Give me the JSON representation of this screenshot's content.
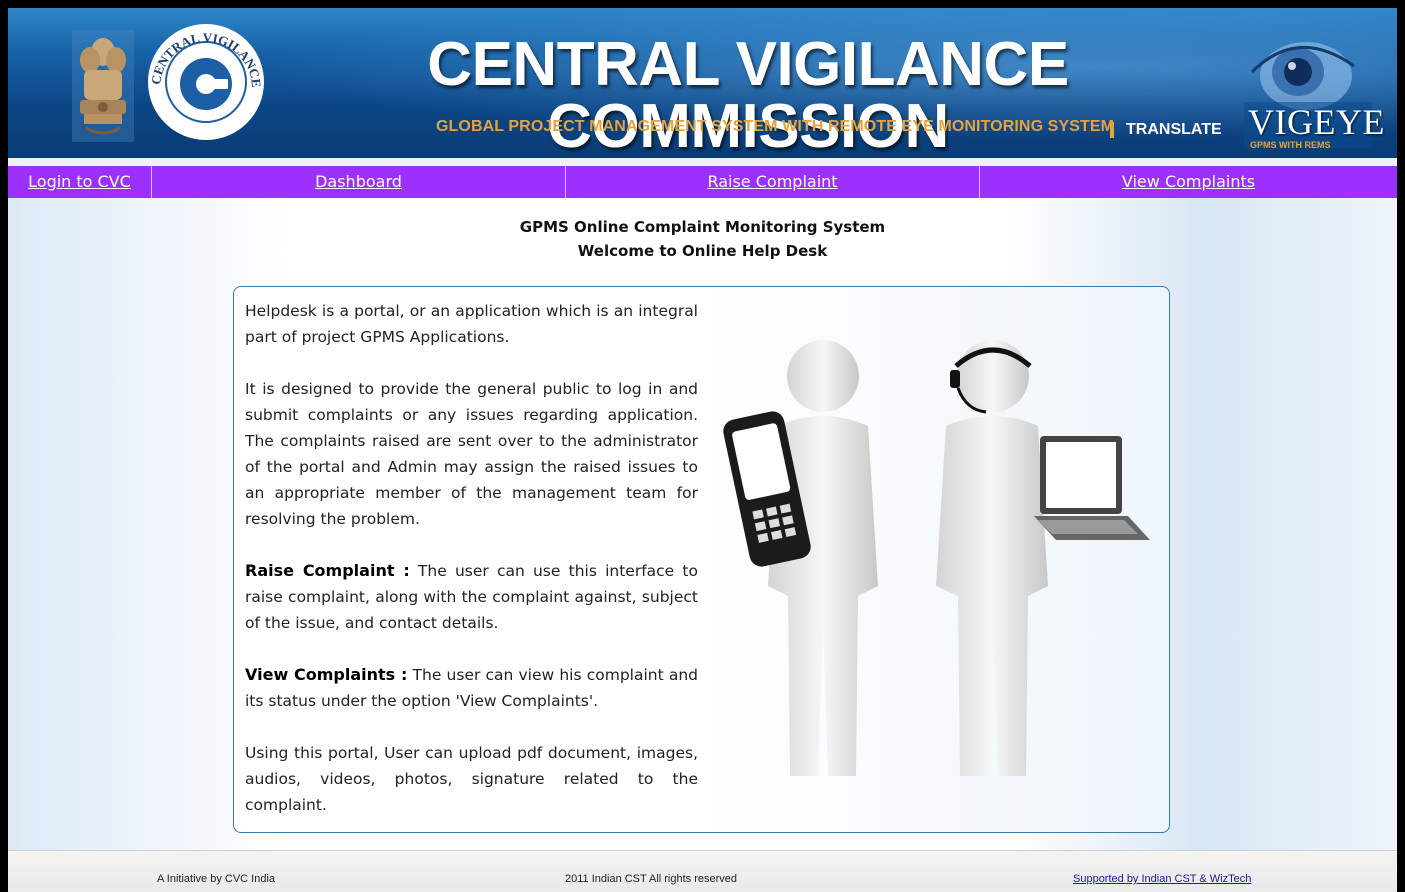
{
  "header": {
    "title": "CENTRAL VIGILANCE COMMISSION",
    "subtitle": "GLOBAL PROJECT MANAGEMENT SYSTEM WITH REMOTE EYE MONITORING SYSTEM",
    "translate_label": "TRANSLATE",
    "logo_text": "CENTRAL VIGILANCE COMMISSION",
    "vigeye_title": "VIGEYE",
    "vigeye_tagline": "GPMS WITH REMS"
  },
  "nav": {
    "items": [
      {
        "label": "Login to CVC"
      },
      {
        "label": "Dashboard"
      },
      {
        "label": "Raise Complaint"
      },
      {
        "label": "View Complaints"
      }
    ]
  },
  "main": {
    "heading_line1": "GPMS Online Complaint Monitoring System",
    "heading_line2": "Welcome to Online Help Desk",
    "para1": "Helpdesk is a portal, or an application which is an integral part of project GPMS Applications.",
    "para2": "It is designed to provide the general public to log in and submit complaints or any issues regarding application. The complaints raised are sent over to the administrator of the portal and Admin may assign the raised issues to an appropriate member of the management team for resolving the problem.",
    "raise_title": "Raise Complaint :",
    "raise_text": " The user can use this interface to raise complaint, along with the complaint against, subject of the issue, and contact details.",
    "view_title": "View Complaints :",
    "view_text": " The user can view his complaint and its status under the option 'View Complaints'.",
    "para_upload": "Using this portal, User can upload pdf document, images, audios, videos, photos, signature related to the complaint."
  },
  "footer": {
    "left": "A Initiative by CVC India",
    "middle": "2011 Indian CST All rights reserved",
    "right": "Supported by Indian CST & WizTech"
  },
  "colors": {
    "nav_bg": "#9b30ff",
    "header_blue": "#0c4686",
    "accent_orange": "#e8a23a",
    "box_border": "#3a7aa8"
  }
}
